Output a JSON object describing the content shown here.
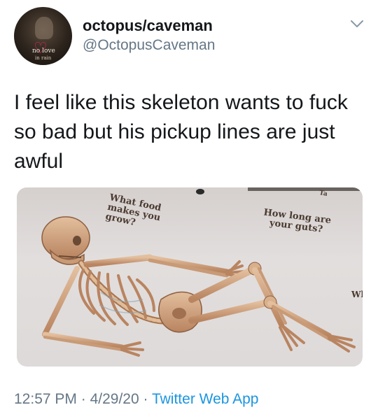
{
  "author": {
    "display_name": "octopus/caveman",
    "handle": "@OctopusCaveman",
    "avatar_text_line1": "no love",
    "avatar_text_line2": "in rain",
    "avatar_icon": "heart-icon"
  },
  "menu": {
    "icon": "chevron-down-icon"
  },
  "tweet": {
    "text": "I feel like this skeleton wants to fuck so bad but his pickup lines are just awful"
  },
  "media": {
    "caption_left": "What food makes you grow?",
    "caption_right": "How long are your guts?",
    "caption_edge_right": "Wh",
    "caption_top_edge": "Ta"
  },
  "meta": {
    "time": "12:57 PM",
    "separator": "·",
    "date": "4/29/20",
    "source": "Twitter Web App"
  },
  "colors": {
    "text": "#14171a",
    "secondary": "#657786",
    "link": "#1b95e0",
    "bone": "#c89a76",
    "bone_shadow": "#8c5e40"
  }
}
